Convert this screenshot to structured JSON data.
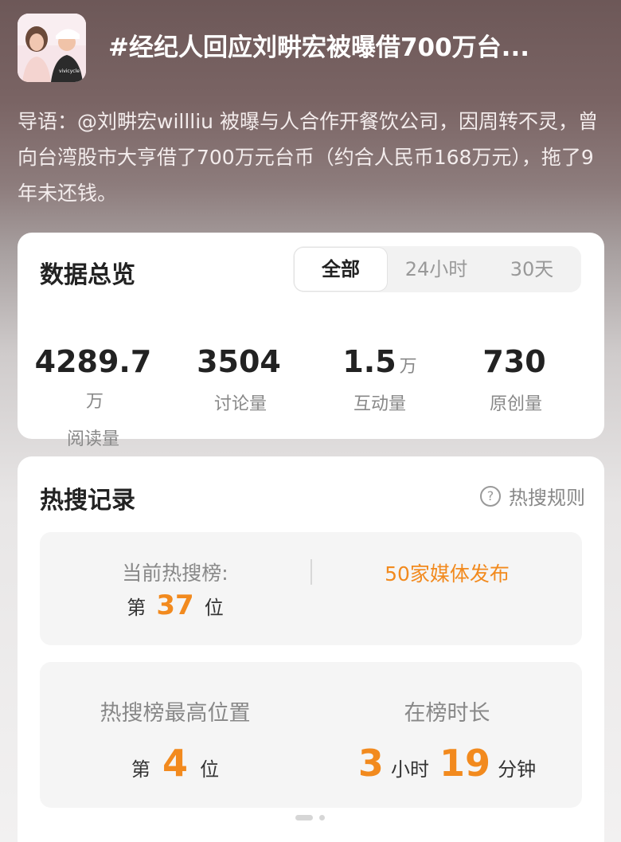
{
  "topic": {
    "title": "#经纪人回应刘畊宏被曝借700万台...",
    "intro": "导语：@刘畊宏willliu 被曝与人合作开餐饮公司，因周转不灵，曾向台湾股市大亨借了700万元台币（约合人民币168万元），拖了9年未还钱。",
    "avatar_shirt_text": "vivicycle"
  },
  "overview": {
    "title": "数据总览",
    "tabs": [
      "全部",
      "24小时",
      "30天"
    ],
    "active_tab": "全部",
    "stats": [
      {
        "value": "4289.7",
        "unit": "万",
        "label": "阅读量"
      },
      {
        "value": "3504",
        "unit": "",
        "label": "讨论量"
      },
      {
        "value": "1.5",
        "unit": "万",
        "label": "互动量"
      },
      {
        "value": "730",
        "unit": "",
        "label": "原创量"
      }
    ]
  },
  "hot_search": {
    "title": "热搜记录",
    "rules_label": "热搜规则",
    "current_label": "当前热搜榜:",
    "rank_prefix": "第",
    "current_rank": "37",
    "rank_suffix": "位",
    "media_text": "50家媒体发布",
    "peak_label": "热搜榜最高位置",
    "peak_rank": "4",
    "duration_label": "在榜时长",
    "duration_hours": "3",
    "hours_unit": "小时",
    "duration_minutes": "19",
    "minutes_unit": "分钟"
  },
  "colors": {
    "accent": "#f28a1e",
    "card_bg": "#ffffff",
    "muted_text": "#888888"
  }
}
